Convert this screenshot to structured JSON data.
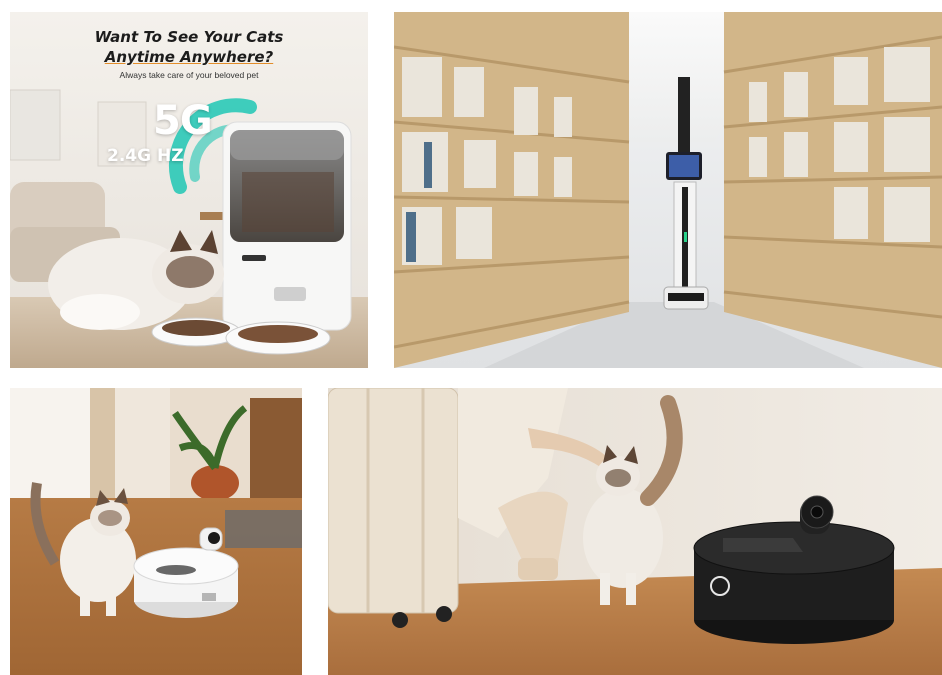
{
  "panels": {
    "feeder_ad": {
      "title_line1": "Want To See Your Cats",
      "title_line2": "Anytime Anywhere?",
      "subtitle": "Always take care of your beloved pet",
      "wifi_5g": "5G",
      "wifi_24g": "2.4G HZ"
    }
  },
  "colors": {
    "accent_orange": "#e28d2b",
    "wifi_teal": "#1fc7b4",
    "shelf_wood": "#d2b689",
    "floor_wood": "#c48a52"
  },
  "icons": [
    "wifi-signal-icon",
    "power-button-icon"
  ]
}
